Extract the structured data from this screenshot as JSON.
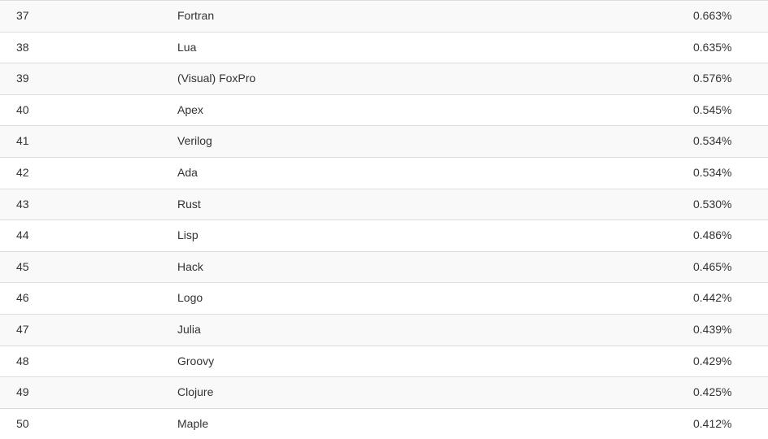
{
  "rows": [
    {
      "rank": "37",
      "name": "Fortran",
      "pct": "0.663%"
    },
    {
      "rank": "38",
      "name": "Lua",
      "pct": "0.635%"
    },
    {
      "rank": "39",
      "name": "(Visual) FoxPro",
      "pct": "0.576%"
    },
    {
      "rank": "40",
      "name": "Apex",
      "pct": "0.545%"
    },
    {
      "rank": "41",
      "name": "Verilog",
      "pct": "0.534%"
    },
    {
      "rank": "42",
      "name": "Ada",
      "pct": "0.534%"
    },
    {
      "rank": "43",
      "name": "Rust",
      "pct": "0.530%"
    },
    {
      "rank": "44",
      "name": "Lisp",
      "pct": "0.486%"
    },
    {
      "rank": "45",
      "name": "Hack",
      "pct": "0.465%"
    },
    {
      "rank": "46",
      "name": "Logo",
      "pct": "0.442%"
    },
    {
      "rank": "47",
      "name": "Julia",
      "pct": "0.439%"
    },
    {
      "rank": "48",
      "name": "Groovy",
      "pct": "0.429%"
    },
    {
      "rank": "49",
      "name": "Clojure",
      "pct": "0.425%"
    },
    {
      "rank": "50",
      "name": "Maple",
      "pct": "0.412%"
    }
  ]
}
